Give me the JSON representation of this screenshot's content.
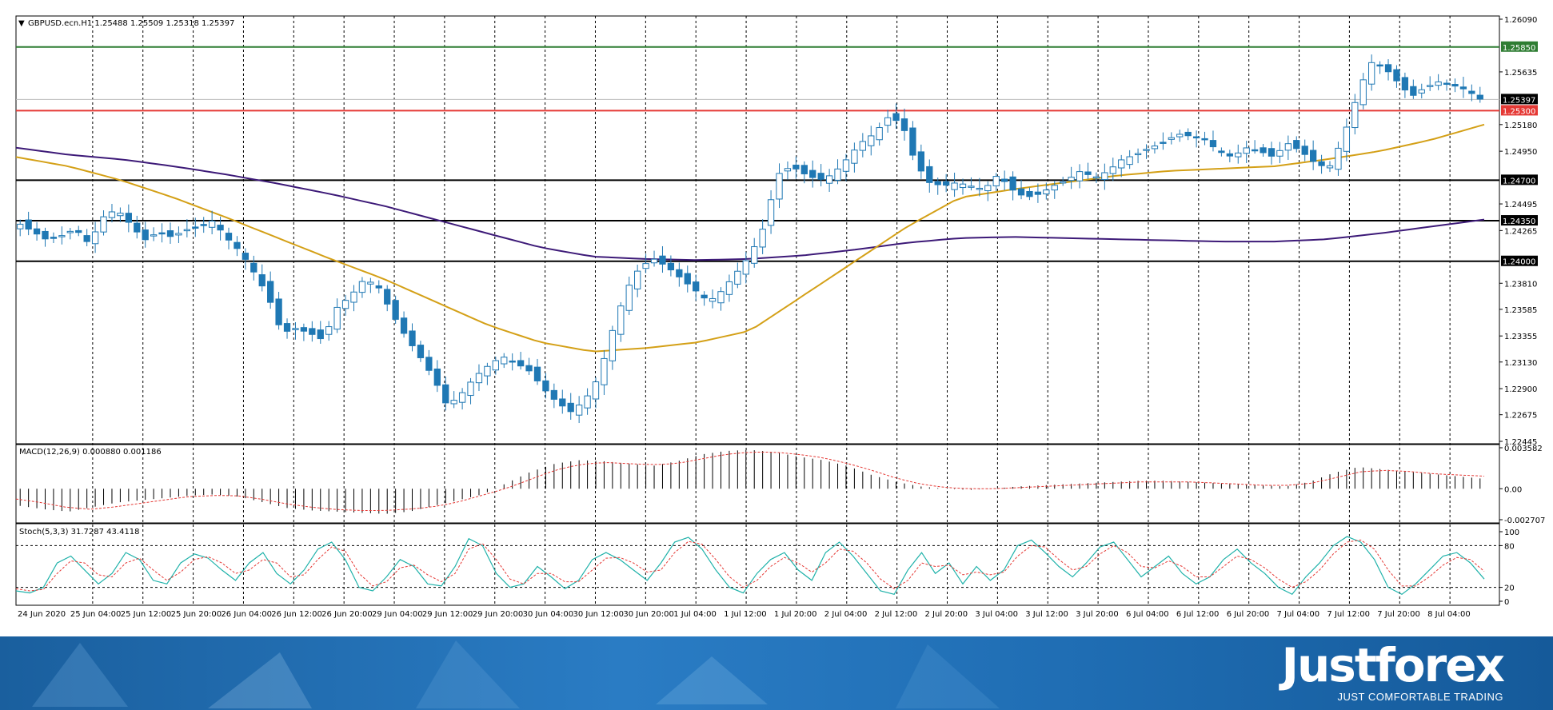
{
  "window": {
    "symbol_header": "GBPUSD.ecn.H1  1.25488 1.25509 1.25318 1.25397"
  },
  "panels": {
    "macd_header": "MACD(12,26,9) 0.000880 0.001186",
    "stoch_header": "Stoch(5,3,3) 31.7287 43.4118"
  },
  "colors": {
    "bull_candle": "#ffffff",
    "bear_candle": "#1f78b4",
    "candle_outline": "#1f78b4",
    "ma_fast": "#d4a017",
    "ma_slow": "#3d1a78",
    "level_green": "#2e7d32",
    "level_red": "#e53935",
    "level_black": "#000000",
    "macd_signal": "#e53935",
    "stoch_main": "#20b2aa",
    "stoch_signal": "#e53935"
  },
  "brand": {
    "name": "Justforex",
    "tagline": "JUST COMFORTABLE TRADING"
  },
  "chart_data": [
    {
      "type": "candlestick",
      "title": "GBPUSD.ecn.H1  1.25488 1.25509 1.25318 1.25397",
      "timeframe": "H1",
      "y_ticks": [
        "1.26090",
        "1.25635",
        "1.25180",
        "1.24950",
        "1.24495",
        "1.24265",
        "1.23810",
        "1.23585",
        "1.23355",
        "1.23130",
        "1.22900",
        "1.22675",
        "1.22445"
      ],
      "ylim": [
        1.22445,
        1.2609
      ],
      "x_ticks": [
        "24 Jun 2020",
        "25 Jun 04:00",
        "25 Jun 12:00",
        "25 Jun 20:00",
        "26 Jun 04:00",
        "26 Jun 12:00",
        "26 Jun 20:00",
        "29 Jun 04:00",
        "29 Jun 12:00",
        "29 Jun 20:00",
        "30 Jun 04:00",
        "30 Jun 12:00",
        "30 Jun 20:00",
        "1 Jul 04:00",
        "1 Jul 12:00",
        "1 Jul 20:00",
        "2 Jul 04:00",
        "2 Jul 12:00",
        "2 Jul 20:00",
        "3 Jul 04:00",
        "3 Jul 12:00",
        "3 Jul 20:00",
        "6 Jul 04:00",
        "6 Jul 12:00",
        "6 Jul 20:00",
        "7 Jul 04:00",
        "7 Jul 12:00",
        "7 Jul 20:00",
        "8 Jul 04:00"
      ],
      "close_path": [
        1.2432,
        1.2425,
        1.2418,
        1.2422,
        1.2428,
        1.2415,
        1.2438,
        1.2445,
        1.2432,
        1.2418,
        1.2425,
        1.2421,
        1.2427,
        1.243,
        1.2435,
        1.242,
        1.2408,
        1.239,
        1.237,
        1.2338,
        1.2342,
        1.2338,
        1.2332,
        1.236,
        1.237,
        1.2385,
        1.2378,
        1.2355,
        1.2335,
        1.2318,
        1.23,
        1.2275,
        1.2285,
        1.23,
        1.231,
        1.2318,
        1.2312,
        1.2305,
        1.229,
        1.2278,
        1.227,
        1.228,
        1.23,
        1.234,
        1.2375,
        1.2395,
        1.2402,
        1.2395,
        1.2385,
        1.2375,
        1.2365,
        1.2375,
        1.239,
        1.2405,
        1.243,
        1.2475,
        1.2482,
        1.2475,
        1.247,
        1.2475,
        1.2488,
        1.2502,
        1.251,
        1.2524,
        1.252,
        1.2485,
        1.2468,
        1.2465,
        1.2468,
        1.2465,
        1.2462,
        1.2475,
        1.2462,
        1.2455,
        1.2458,
        1.2465,
        1.247,
        1.2478,
        1.2472,
        1.2478,
        1.2488,
        1.2492,
        1.2498,
        1.2502,
        1.251,
        1.2508,
        1.2505,
        1.2495,
        1.249,
        1.2498,
        1.2495,
        1.249,
        1.2502,
        1.2495,
        1.2485,
        1.248,
        1.2505,
        1.254,
        1.2572,
        1.2568,
        1.2555,
        1.2542,
        1.255,
        1.2555,
        1.2552,
        1.2548,
        1.254
      ],
      "levels": [
        {
          "value": 1.2585,
          "label": "1.25850",
          "color": "#2e7d32"
        },
        {
          "value": 1.253,
          "label": "1.25300",
          "color": "#e53935"
        },
        {
          "value": 1.247,
          "label": "1.24700",
          "color": "#000000"
        },
        {
          "value": 1.2435,
          "label": "1.24350",
          "color": "#000000"
        },
        {
          "value": 1.24,
          "label": "1.24000",
          "color": "#000000"
        }
      ],
      "current_price": {
        "value": 1.25397,
        "label": "1.25397"
      },
      "ma_fast_path": [
        1.249,
        1.2482,
        1.247,
        1.2455,
        1.2438,
        1.242,
        1.2402,
        1.2385,
        1.2365,
        1.2345,
        1.233,
        1.2322,
        1.2325,
        1.233,
        1.234,
        1.237,
        1.24,
        1.243,
        1.2455,
        1.2462,
        1.2468,
        1.2474,
        1.2478,
        1.248,
        1.2482,
        1.2488,
        1.2495,
        1.2505,
        1.2518
      ],
      "ma_slow_path": [
        1.2498,
        1.2492,
        1.2488,
        1.2482,
        1.2475,
        1.2467,
        1.2458,
        1.2448,
        1.2436,
        1.2424,
        1.2412,
        1.2404,
        1.2402,
        1.2401,
        1.2402,
        1.2405,
        1.241,
        1.2416,
        1.242,
        1.2421,
        1.242,
        1.2419,
        1.2418,
        1.2417,
        1.2417,
        1.2419,
        1.2424,
        1.243,
        1.2436
      ]
    },
    {
      "type": "bar",
      "title": "MACD(12,26,9) 0.000880 0.001186",
      "y_ticks": [
        "0.003582",
        "0.00",
        "-0.002707"
      ],
      "ylim": [
        -0.002707,
        0.003582
      ],
      "values_path": [
        -0.0015,
        -0.0018,
        -0.002,
        -0.0016,
        -0.0012,
        -0.001,
        -0.0008,
        -0.0006,
        -0.0005,
        -0.0007,
        -0.0012,
        -0.0017,
        -0.0019,
        -0.002,
        -0.0021,
        -0.0022,
        -0.002,
        -0.0015,
        -0.001,
        -0.0005,
        0.0005,
        0.0015,
        0.0022,
        0.0025,
        0.0024,
        0.0022,
        0.002,
        0.0024,
        0.003,
        0.0033,
        0.0034,
        0.0032,
        0.0028,
        0.0025,
        0.002,
        0.0012,
        0.0006,
        0.0002,
        0.0,
        -0.0001,
        0.0,
        0.0002,
        0.0003,
        0.0004,
        0.0005,
        0.0006,
        0.0007,
        0.0007,
        0.0006,
        0.0005,
        0.0004,
        0.0003,
        0.0002,
        0.0006,
        0.0014,
        0.0019,
        0.0017,
        0.0015,
        0.0013,
        0.0011,
        0.0009
      ],
      "signal_path": [
        -0.0009,
        -0.0012,
        -0.0016,
        -0.0018,
        -0.0016,
        -0.0013,
        -0.001,
        -0.0007,
        -0.0006,
        -0.0006,
        -0.0009,
        -0.0013,
        -0.0016,
        -0.0018,
        -0.0019,
        -0.0019,
        -0.0018,
        -0.0016,
        -0.0012,
        -0.0006,
        0.0,
        0.0008,
        0.0016,
        0.0021,
        0.0023,
        0.0022,
        0.0021,
        0.0022,
        0.0026,
        0.003,
        0.0032,
        0.0032,
        0.003,
        0.0027,
        0.0022,
        0.0016,
        0.0009,
        0.0004,
        0.0001,
        0.0,
        0.0,
        0.0001,
        0.0002,
        0.0003,
        0.0004,
        0.0005,
        0.0006,
        0.0006,
        0.0006,
        0.0005,
        0.0004,
        0.0003,
        0.0003,
        0.0005,
        0.001,
        0.0015,
        0.0016,
        0.0015,
        0.0013,
        0.0012,
        0.0011
      ]
    },
    {
      "type": "line",
      "title": "Stoch(5,3,3) 31.7287 43.4118",
      "y_ticks": [
        "100",
        "80",
        "20",
        "0"
      ],
      "ylim": [
        0,
        100
      ],
      "levels": [
        80,
        20
      ],
      "main_path": [
        15,
        12,
        20,
        55,
        65,
        45,
        25,
        40,
        70,
        60,
        30,
        25,
        55,
        68,
        62,
        45,
        30,
        55,
        70,
        40,
        25,
        45,
        75,
        85,
        60,
        20,
        15,
        35,
        60,
        50,
        25,
        22,
        50,
        90,
        80,
        40,
        20,
        25,
        50,
        35,
        18,
        30,
        60,
        70,
        60,
        45,
        30,
        55,
        85,
        92,
        75,
        45,
        20,
        12,
        40,
        60,
        70,
        45,
        30,
        70,
        85,
        65,
        40,
        15,
        10,
        45,
        70,
        40,
        55,
        25,
        50,
        30,
        45,
        80,
        88,
        70,
        50,
        35,
        55,
        78,
        85,
        60,
        35,
        50,
        65,
        40,
        25,
        35,
        60,
        75,
        55,
        40,
        20,
        10,
        35,
        55,
        80,
        93,
        85,
        60,
        20,
        10,
        25,
        45,
        65,
        70,
        55,
        32
      ],
      "signal_path": [
        18,
        15,
        17,
        40,
        58,
        55,
        38,
        35,
        55,
        62,
        45,
        30,
        42,
        60,
        64,
        55,
        40,
        45,
        60,
        55,
        35,
        38,
        60,
        78,
        72,
        40,
        22,
        28,
        48,
        52,
        38,
        28,
        40,
        75,
        83,
        60,
        32,
        25,
        40,
        40,
        28,
        28,
        45,
        62,
        63,
        55,
        42,
        45,
        70,
        86,
        82,
        60,
        35,
        20,
        30,
        50,
        63,
        55,
        42,
        55,
        75,
        72,
        55,
        32,
        18,
        30,
        55,
        50,
        52,
        38,
        42,
        38,
        42,
        65,
        80,
        78,
        60,
        45,
        50,
        68,
        80,
        70,
        50,
        48,
        58,
        50,
        35,
        35,
        50,
        65,
        60,
        48,
        32,
        20,
        28,
        45,
        68,
        85,
        88,
        75,
        45,
        22,
        22,
        35,
        52,
        63,
        60,
        43
      ]
    }
  ]
}
